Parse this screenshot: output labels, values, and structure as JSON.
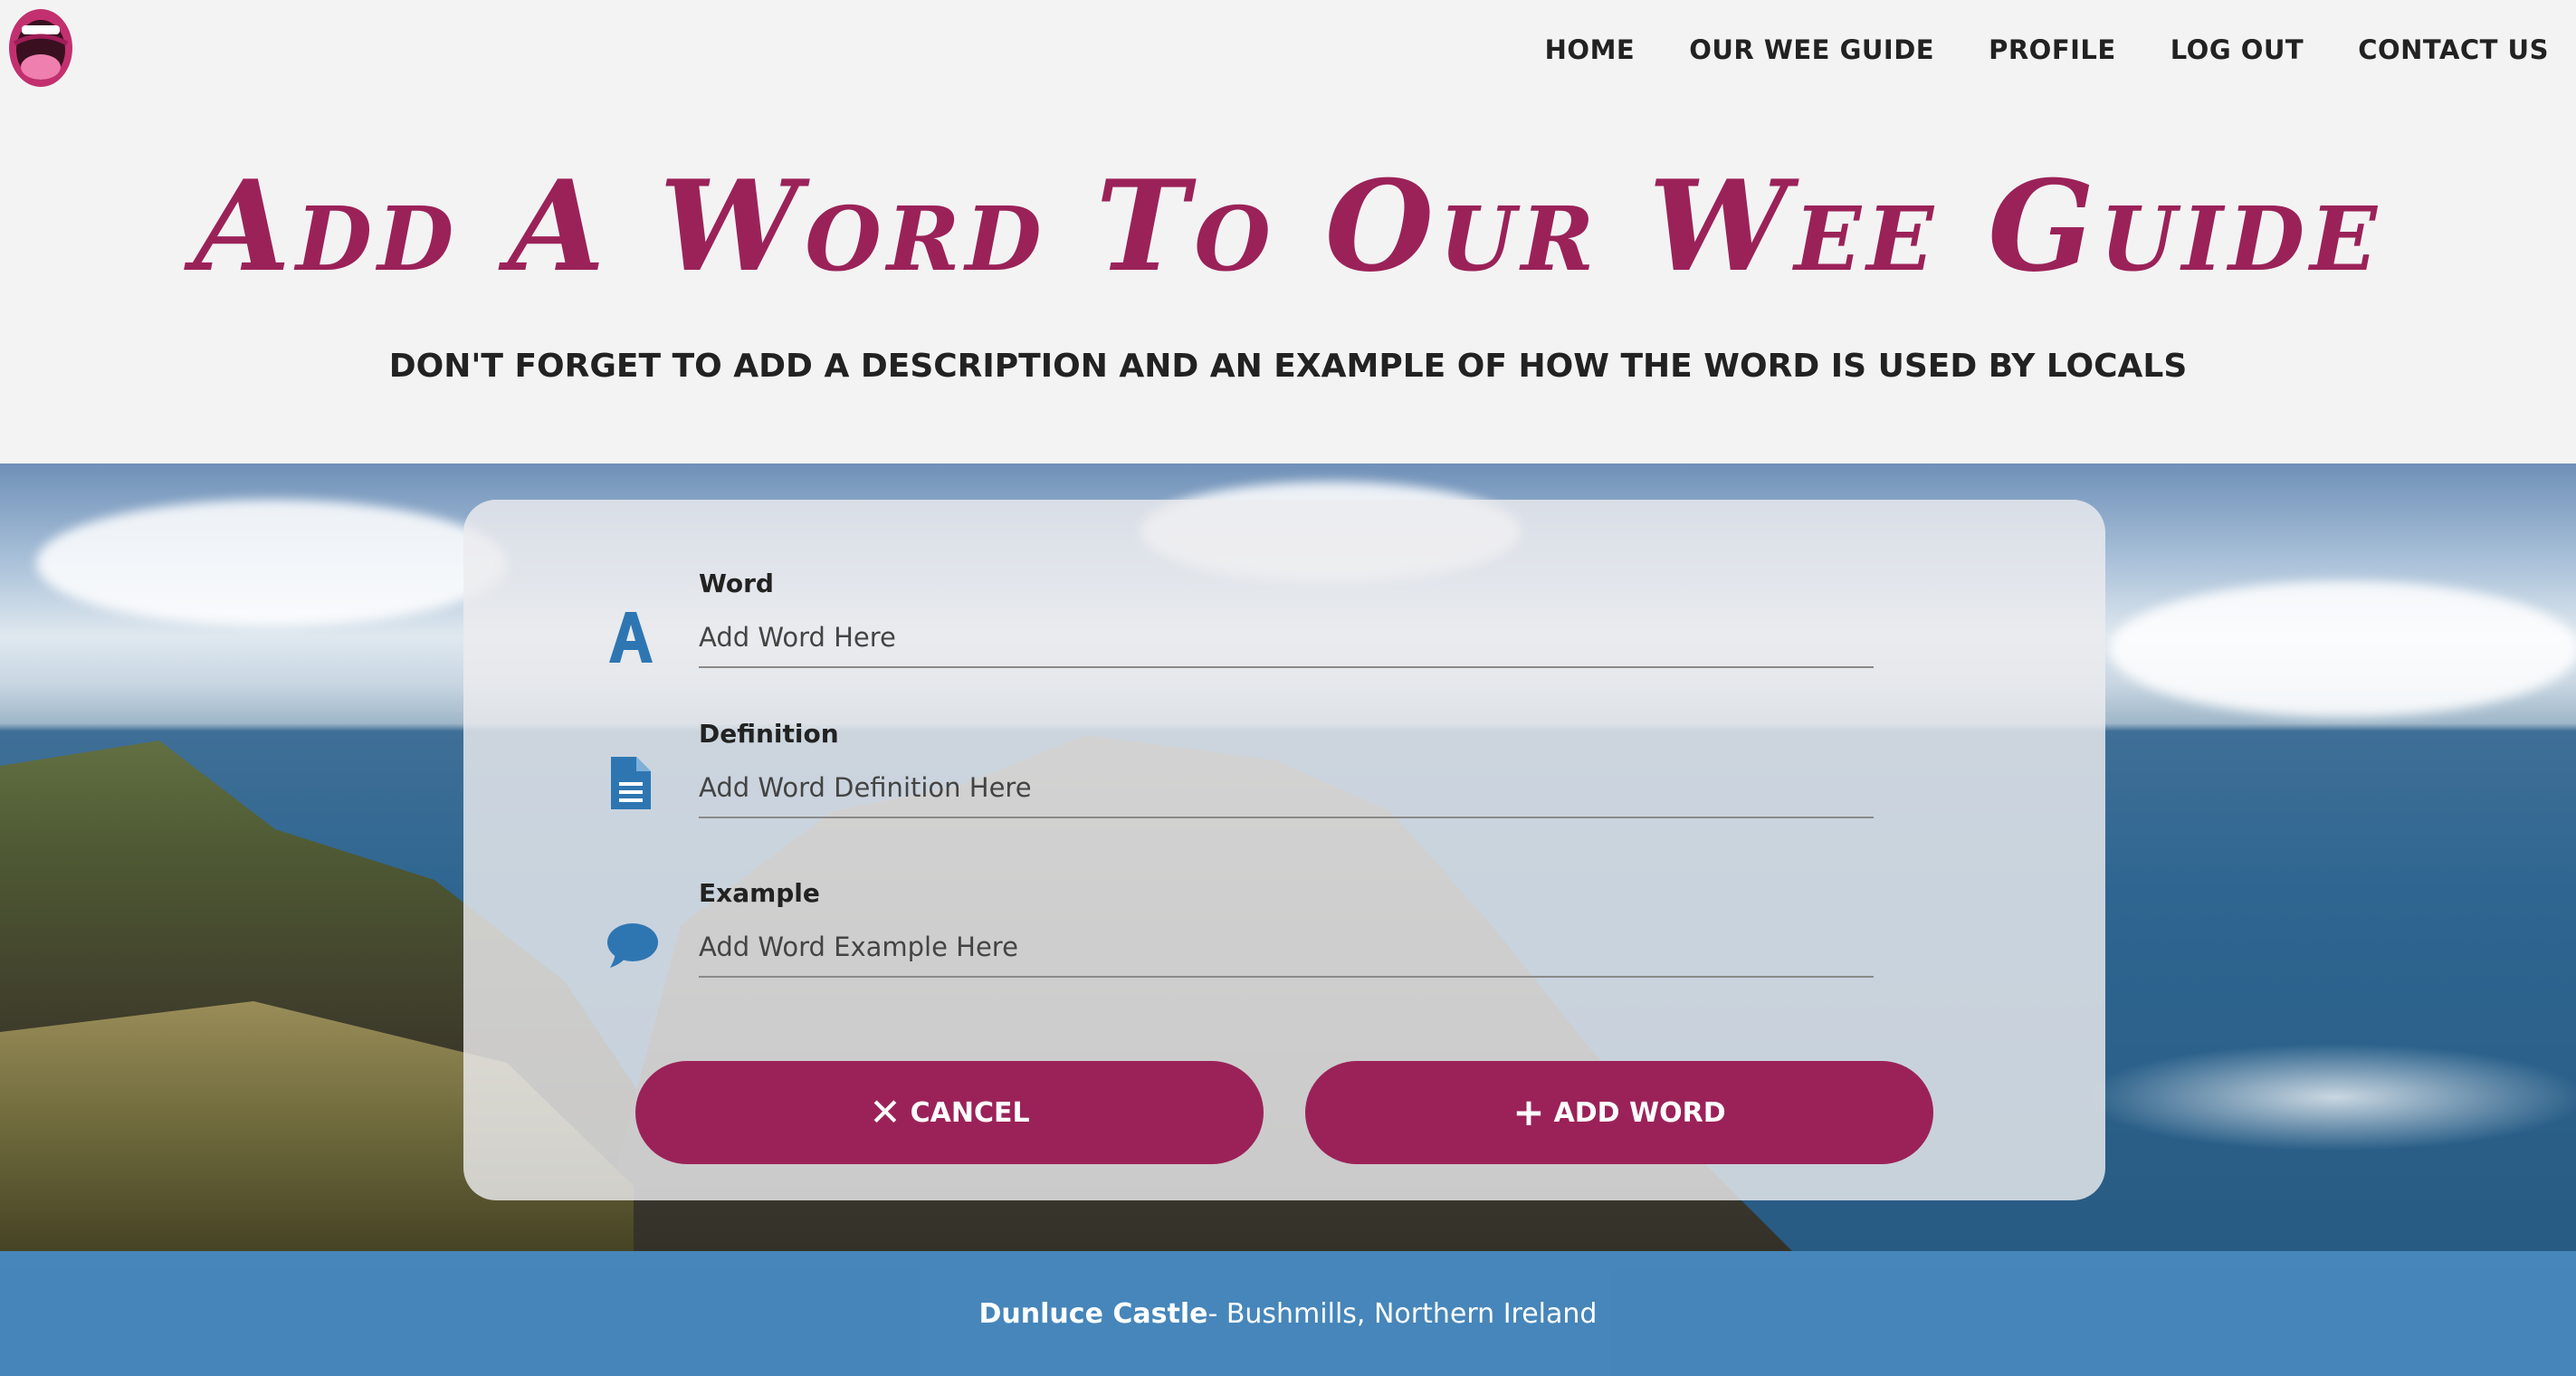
{
  "nav": {
    "items": [
      {
        "label": "HOME"
      },
      {
        "label": "OUR WEE GUIDE"
      },
      {
        "label": "PROFILE"
      },
      {
        "label": "LOG OUT"
      },
      {
        "label": "CONTACT US"
      }
    ]
  },
  "header": {
    "title": "Add A Word To Our Wee Guide",
    "subtitle": "DON'T FORGET TO ADD A DESCRIPTION AND AN EXAMPLE OF HOW THE WORD IS USED BY LOCALS"
  },
  "form": {
    "word": {
      "label": "Word",
      "placeholder": "Add Word Here",
      "icon": "letter-a-icon"
    },
    "definition": {
      "label": "Definition",
      "placeholder": "Add Word Definition Here",
      "icon": "document-icon"
    },
    "example": {
      "label": "Example",
      "placeholder": "Add Word Example Here",
      "icon": "speech-bubble-icon"
    },
    "cancel_label": "CANCEL",
    "add_label": "ADD WORD"
  },
  "footer": {
    "place": "Dunluce Castle",
    "location": " - Bushmills, Northern Ireland"
  },
  "colors": {
    "accent": "#9b2259",
    "icon_blue": "#2e76b2",
    "footer_bg": "#2e76b2"
  }
}
